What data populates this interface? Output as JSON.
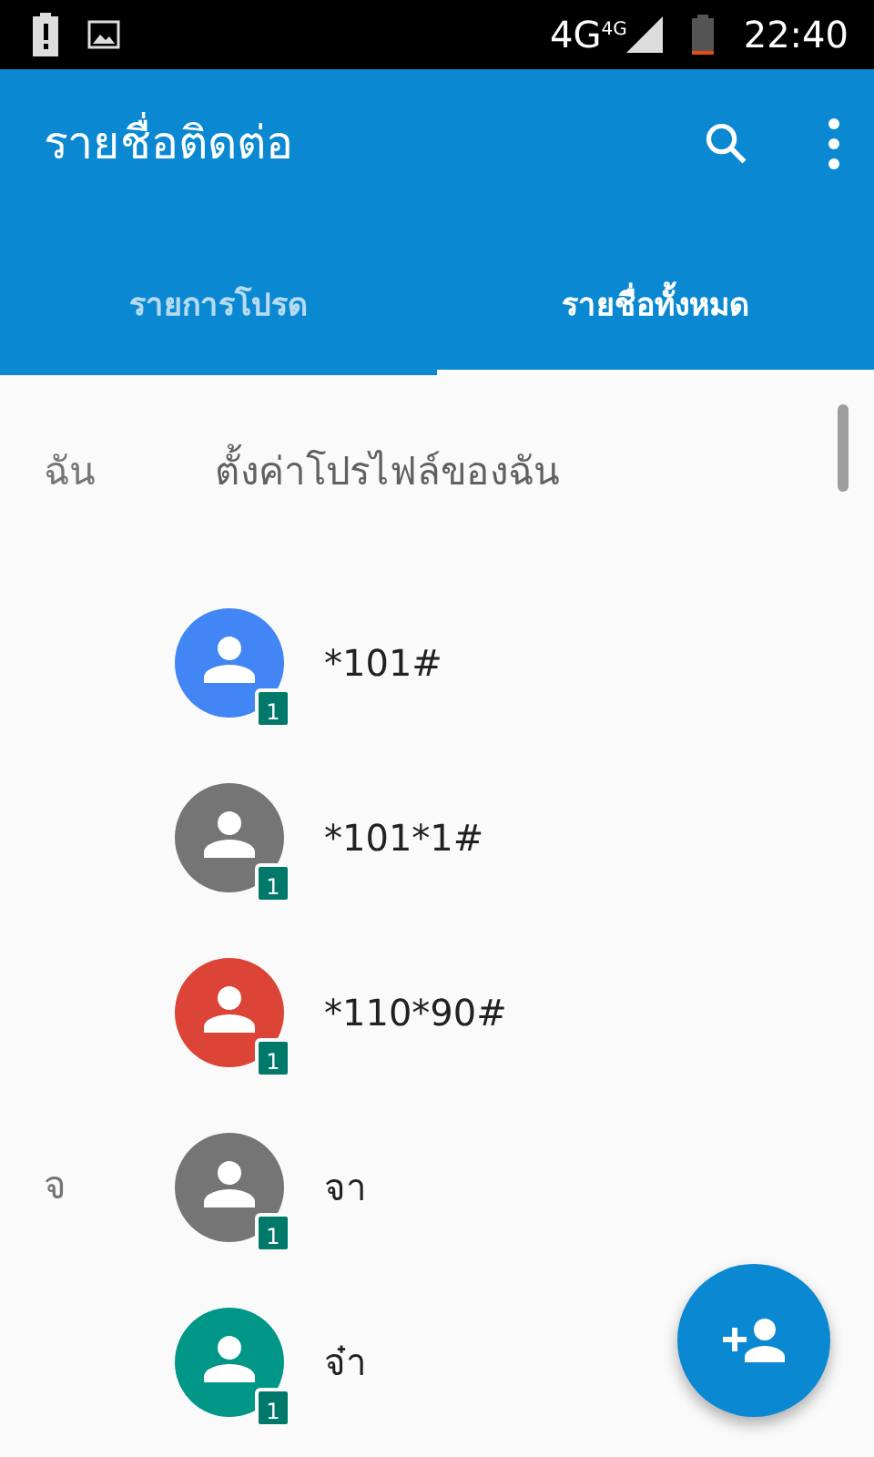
{
  "status_bar": {
    "network": "4G",
    "network_small": "4G",
    "time": "22:40"
  },
  "app_bar": {
    "title": "รายชื่อติดต่อ"
  },
  "tabs": [
    {
      "label": "รายการโปรด",
      "selected": false
    },
    {
      "label": "รายชื่อทั้งหมด",
      "selected": true
    }
  ],
  "me": {
    "section": "ฉัน",
    "label": "ตั้งค่าโปรไฟล์ของฉัน"
  },
  "contacts": [
    {
      "name": "*101#",
      "color": "#4285f4",
      "sim": "1"
    },
    {
      "name": "*101*1#",
      "color": "#757575",
      "sim": "1"
    },
    {
      "name": "*110*90#",
      "color": "#db4437",
      "sim": "1"
    },
    {
      "section": "จ",
      "name": "จา",
      "color": "#757575",
      "sim": "1"
    },
    {
      "name": "จ๋า",
      "color": "#009688",
      "sim": "1"
    }
  ]
}
